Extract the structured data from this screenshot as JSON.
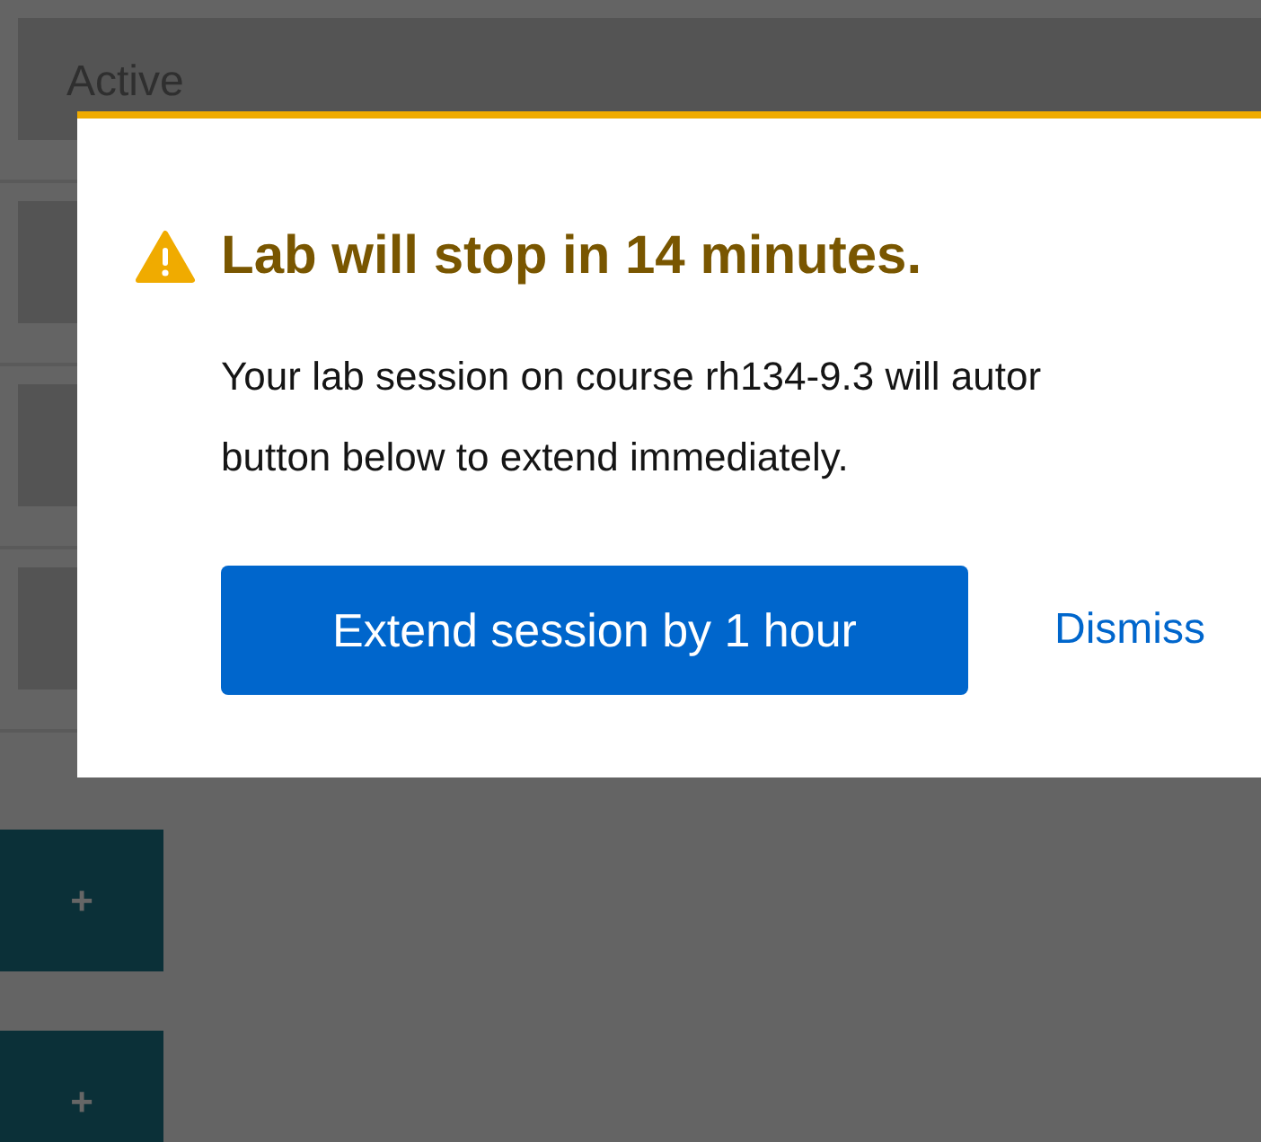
{
  "background": {
    "rows": [
      {
        "label": "Active"
      },
      {},
      {},
      {}
    ],
    "add_buttons": [
      "+",
      "+"
    ]
  },
  "dialog": {
    "title": "Lab will stop in 14 minutes.",
    "body_lines": [
      "Your lab session on course rh134-9.3 will autor",
      "button below to extend immediately."
    ],
    "primary_button": "Extend session by 1 hour",
    "link": "Dismiss"
  }
}
